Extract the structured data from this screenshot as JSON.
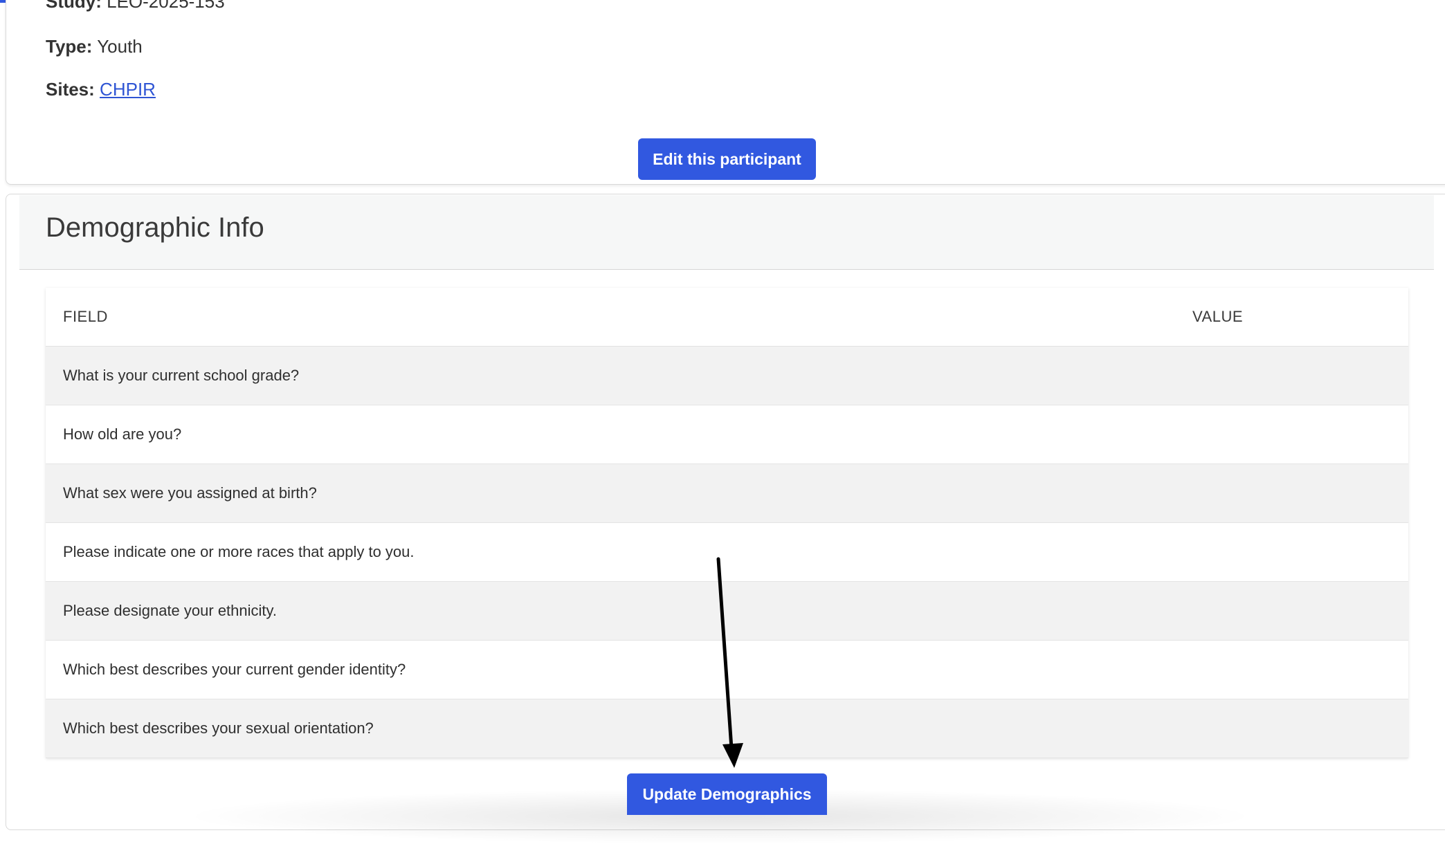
{
  "participant": {
    "study_label": "Study:",
    "study_value": "LEO-2025-153",
    "type_label": "Type:",
    "type_value": "Youth",
    "sites_label": "Sites:",
    "sites_value": "CHPIR",
    "edit_button": "Edit this participant"
  },
  "demographics": {
    "title": "Demographic Info",
    "columns": {
      "field": "FIELD",
      "value": "VALUE"
    },
    "rows": [
      {
        "field": "What is your current school grade?",
        "value": ""
      },
      {
        "field": "How old are you?",
        "value": ""
      },
      {
        "field": "What sex were you assigned at birth?",
        "value": ""
      },
      {
        "field": "Please indicate one or more races that apply to you.",
        "value": ""
      },
      {
        "field": "Please designate your ethnicity.",
        "value": ""
      },
      {
        "field": "Which best describes your current gender identity?",
        "value": ""
      },
      {
        "field": "Which best describes your sexual orientation?",
        "value": ""
      }
    ],
    "update_button": "Update Demographics"
  },
  "colors": {
    "accent": "#3158e0",
    "link": "#2f55d4",
    "row_shade": "#f2f2f2",
    "arrow": "#000000"
  },
  "icons": {
    "annotation": "arrow-down-icon"
  }
}
